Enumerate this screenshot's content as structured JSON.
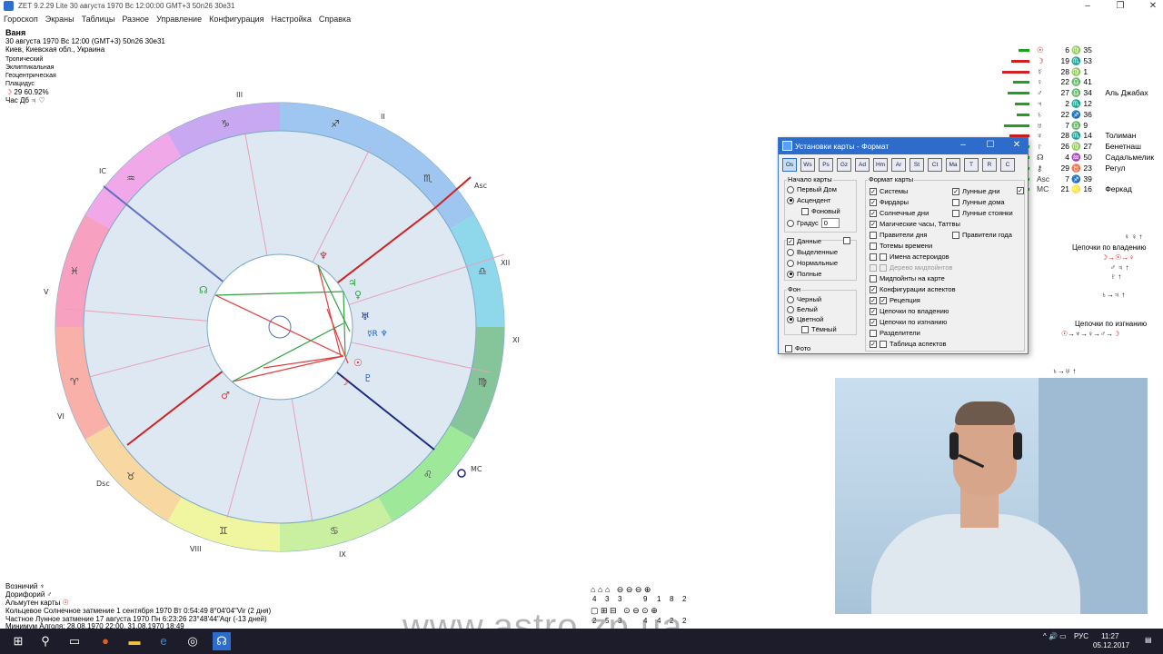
{
  "window": {
    "title": "ZET 9.2.29 Lite   30 августа 1970  Вс  12:00:00 GMT+3 50n26  30e31"
  },
  "menu": [
    "Гороскоп",
    "Экраны",
    "Таблицы",
    "Разное",
    "Управление",
    "Конфигурация",
    "Настройка",
    "Справка"
  ],
  "info": {
    "name": "Ваня",
    "datetime": "30 августа 1970  Вс  12:00 (GMT+3) 50n26  30e31",
    "place": "Киев, Киевская обл., Украина",
    "lines": [
      "Тропический",
      "Эклиптикальная",
      "Геоцентрическая",
      "Плацидус"
    ],
    "moon_phase": "29 60.92%",
    "hour": "Час Дб"
  },
  "houses": [
    "III",
    "II",
    "IC",
    "Asc",
    "XII",
    "V",
    "XI",
    "VI",
    "MC",
    "Dsc",
    "VIII",
    "IX"
  ],
  "right_table": [
    {
      "deg": "6",
      "sign": "♍",
      "min": "35",
      "label": ""
    },
    {
      "deg": "19",
      "sign": "♏",
      "min": "53",
      "label": ""
    },
    {
      "deg": "28",
      "sign": "♍",
      "min": "1",
      "label": ""
    },
    {
      "deg": "22",
      "sign": "♎",
      "min": "41",
      "label": ""
    },
    {
      "deg": "27",
      "sign": "♎",
      "min": "34",
      "label": "Аль Джабах"
    },
    {
      "deg": "2",
      "sign": "♏",
      "min": "12",
      "label": ""
    },
    {
      "deg": "22",
      "sign": "♐",
      "min": "36",
      "label": ""
    },
    {
      "deg": "7",
      "sign": "♎",
      "min": "9",
      "label": ""
    },
    {
      "deg": "28",
      "sign": "♏",
      "min": "14",
      "label": "Толиман"
    },
    {
      "deg": "26",
      "sign": "♍",
      "min": "27",
      "label": "Бенетнаш"
    },
    {
      "deg": "4",
      "sign": "♒",
      "min": "50",
      "label": "Садальмелик"
    },
    {
      "deg": "29",
      "sign": "♉",
      "min": "23",
      "label": "Регул"
    },
    {
      "deg": "7",
      "sign": "♐",
      "min": "39",
      "label": ""
    },
    {
      "deg": "21",
      "sign": "♌",
      "min": "16",
      "label": "Феркад"
    }
  ],
  "chains": {
    "ownership_title": "Цепочки по владению",
    "exile_title": "Цепочки по изгнанию"
  },
  "dialog": {
    "title": "Установки карты - Формат",
    "toolbar": [
      "Os",
      "Ws",
      "Ps",
      "Gz",
      "Ad",
      "Hm",
      "Ar",
      "St",
      "Ct",
      "Ma",
      "T",
      "R",
      "C"
    ],
    "start_group": "Начало карты",
    "start_options": [
      "Первый Дом",
      "Асцендент",
      "Фоновый",
      "Градус"
    ],
    "degree_value": "0",
    "data_group": "Данные",
    "data_options": [
      "Выделенные",
      "Нормальные",
      "Полные"
    ],
    "bg_group": "Фон",
    "bg_options": [
      "Черный",
      "Белый",
      "Цветной",
      "Тёмный"
    ],
    "photo": "Фото",
    "format_group": "Формат карты",
    "format_left": [
      "Системы",
      "Фирдары",
      "Солнечные дни",
      "Магические часы, Таттвы",
      "Правители дня",
      "Тотемы времени",
      "Имена астероидов",
      "Дерево мидпойнтов",
      "Мидпойнты на карте",
      "Конфигурации аспектов",
      "Рецепция",
      "Цепочки по владению",
      "Цепочки по изгнанию",
      "Разделители",
      "Таблица аспектов"
    ],
    "format_right": [
      "Лунные дни",
      "Лунные дома",
      "Лунные стоянки",
      "Правители года"
    ]
  },
  "bottom": {
    "lines": [
      "Возничий",
      "Дорифорий",
      "Альмутен карты",
      "Кольцевое Солнечное затмение 1 сентября 1970 Вт  0:54:49  8°04'04\"Vir (2 дня)",
      "Частное Лунное затмение 17 августа 1970 Пн  6:23:26 23°48'44\"Aqr (-13 дней)",
      "Минимум Алголя: 28.08.1970 22:00,  31.08.1970 18:49"
    ],
    "stats_row1": [
      "4",
      "3",
      "3",
      "9",
      "1",
      "8",
      "2"
    ],
    "stats_row2": [
      "2",
      "5",
      "3",
      "4",
      "4",
      "2",
      "2"
    ]
  },
  "watermark": "www.astro.zp.ua",
  "taskbar": {
    "lang": "РУС",
    "time": "11:27",
    "date": "05.12.2017"
  }
}
